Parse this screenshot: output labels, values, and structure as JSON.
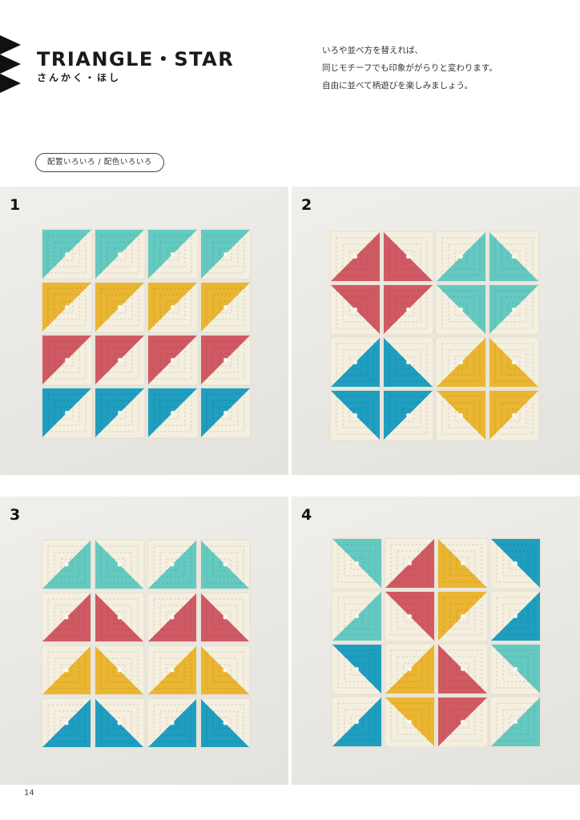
{
  "header": {
    "title": "TRIANGLE・STAR",
    "subtitle": "さんかく・ほし"
  },
  "intro": {
    "lines": [
      "いろや並べ方を替えれば、",
      "同じモチーフでも印象ががらりと変わります。",
      "自由に並べて柄遊びを楽しみましょう。"
    ]
  },
  "tag": {
    "label": "配置いろいろ / 配色いろいろ"
  },
  "colors": {
    "cream": "#f5efdf",
    "turquoise": "#64c9c0",
    "yellow": "#eab531",
    "pink": "#d05a64",
    "blue": "#1f9ec0",
    "background": "#ecebe7"
  },
  "panels": [
    {
      "number": "1",
      "rows": 4,
      "cols": 4,
      "squares": [
        [
          "turquoise:tl",
          "turquoise:tl",
          "turquoise:tl",
          "turquoise:tl"
        ],
        [
          "yellow:tl",
          "yellow:tl",
          "yellow:tl",
          "yellow:tl"
        ],
        [
          "pink:tl",
          "pink:tl",
          "pink:tl",
          "pink:tl"
        ],
        [
          "blue:tl",
          "blue:tl",
          "blue:tl",
          "blue:tl"
        ]
      ]
    },
    {
      "number": "2",
      "rows": 4,
      "cols": 4,
      "squares": [
        [
          "pink:br",
          "pink:bl",
          "turquoise:br",
          "turquoise:bl"
        ],
        [
          "pink:tr",
          "pink:tl",
          "turquoise:tr",
          "turquoise:tl"
        ],
        [
          "blue:br",
          "blue:bl",
          "yellow:br",
          "yellow:bl"
        ],
        [
          "blue:tr",
          "blue:tl",
          "yellow:tr",
          "yellow:tl"
        ]
      ]
    },
    {
      "number": "3",
      "rows": 4,
      "cols": 4,
      "squares": [
        [
          "turquoise:br",
          "turquoise:bl",
          "turquoise:br",
          "turquoise:bl"
        ],
        [
          "pink:br",
          "pink:bl",
          "pink:br",
          "pink:bl"
        ],
        [
          "yellow:br",
          "yellow:bl",
          "yellow:br",
          "yellow:bl"
        ],
        [
          "blue:br",
          "blue:bl",
          "blue:br",
          "blue:bl"
        ]
      ]
    },
    {
      "number": "4",
      "rows": 4,
      "cols": 4,
      "squares": [
        [
          "turquoise:tr",
          "pink:br",
          "yellow:bl",
          "blue:tr"
        ],
        [
          "turquoise:br",
          "pink:tr",
          "yellow:tl",
          "blue:br"
        ],
        [
          "blue:tr",
          "yellow:br",
          "pink:bl",
          "turquoise:tr"
        ],
        [
          "blue:br",
          "yellow:tr",
          "pink:tl",
          "turquoise:br"
        ]
      ]
    }
  ],
  "page_number": "14"
}
